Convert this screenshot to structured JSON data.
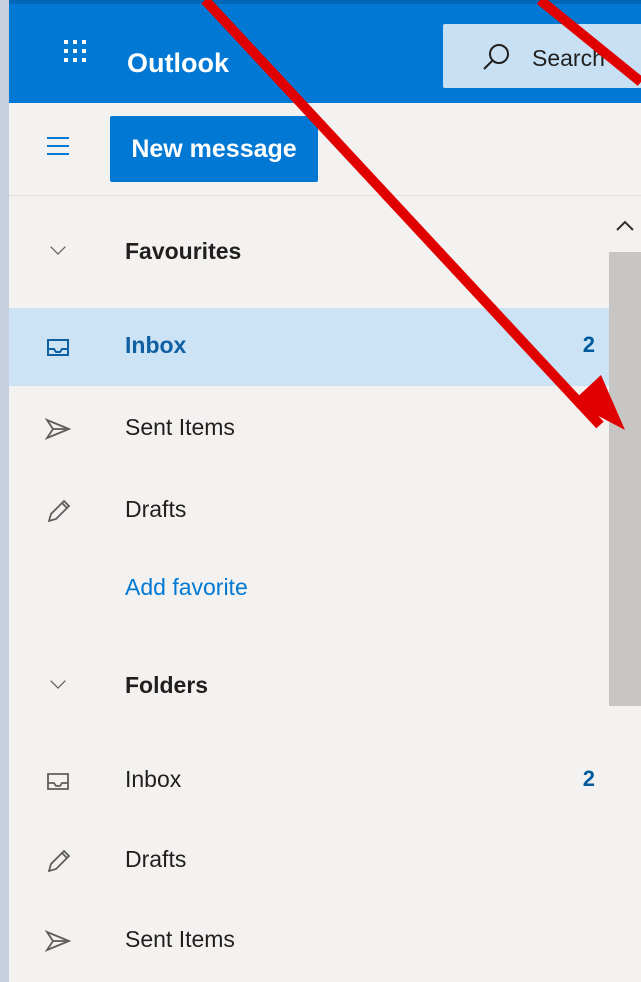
{
  "header": {
    "app_title": "Outlook",
    "search_label": "Search",
    "waffle_icon": "app-launcher-icon",
    "search_icon": "search-icon",
    "accent_color": "#0078d4"
  },
  "command_bar": {
    "menu_icon": "hamburger-icon",
    "new_message_label": "New message"
  },
  "favourites": {
    "heading": "Favourites",
    "items": [
      {
        "label": "Inbox",
        "count": "2",
        "icon": "inbox-icon",
        "selected": true
      },
      {
        "label": "Sent Items",
        "count": "",
        "icon": "send-icon"
      },
      {
        "label": "Drafts",
        "count": "",
        "icon": "pencil-icon"
      }
    ],
    "add_favorite_label": "Add favorite"
  },
  "folders": {
    "heading": "Folders",
    "items": [
      {
        "label": "Inbox",
        "count": "2",
        "icon": "inbox-icon"
      },
      {
        "label": "Drafts",
        "count": "",
        "icon": "pencil-icon"
      },
      {
        "label": "Sent Items",
        "count": "",
        "icon": "send-icon"
      }
    ]
  },
  "annotation": {
    "arrow_color": "#e00000"
  }
}
